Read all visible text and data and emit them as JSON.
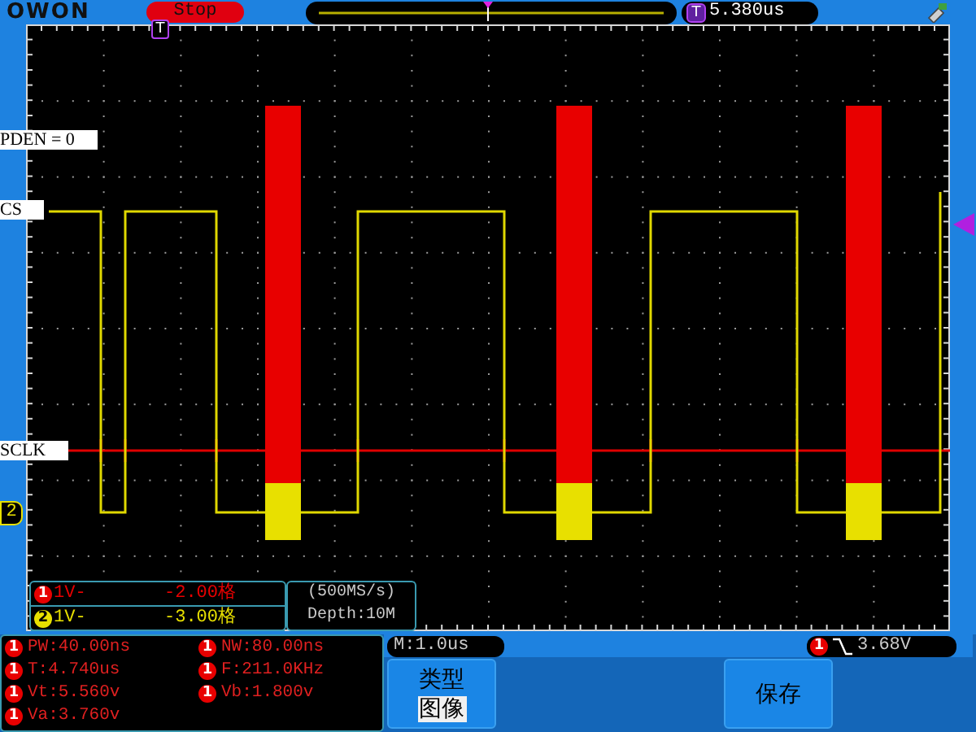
{
  "top_bar": {
    "logo": "OWON",
    "run_state": "Stop",
    "trigger_icon": "T",
    "trigger_time": "5.380us"
  },
  "graticule": {
    "trigger_marker": "T",
    "channel_marker": "2",
    "trace_labels": [
      {
        "text": "PDEN = 0"
      },
      {
        "text": "CS"
      },
      {
        "text": "SCLK"
      }
    ]
  },
  "channels": [
    {
      "number": "1",
      "color": "#e80000",
      "scale": "1V-",
      "offset": "-2.00格"
    },
    {
      "number": "2",
      "color": "#e8e000",
      "scale": "1V-",
      "offset": "-3.00格"
    }
  ],
  "acquisition": {
    "sample_rate": "(500MS/s)",
    "depth": "Depth:10M"
  },
  "measurements": [
    {
      "channel": "1",
      "text": "PW:40.00ns"
    },
    {
      "channel": "1",
      "text": "NW:80.00ns"
    },
    {
      "channel": "1",
      "text": "T:4.740us"
    },
    {
      "channel": "1",
      "text": "F:211.0KHz"
    },
    {
      "channel": "1",
      "text": "Vt:5.560v"
    },
    {
      "channel": "1",
      "text": "Vb:1.800v"
    },
    {
      "channel": "1",
      "text": "Va:3.760v"
    }
  ],
  "timebase": "M:1.0us",
  "trigger": {
    "channel": "1",
    "level": "3.68V"
  },
  "menu_buttons": [
    {
      "title": "类型",
      "value": "图像"
    },
    {
      "title": "保存"
    }
  ]
}
